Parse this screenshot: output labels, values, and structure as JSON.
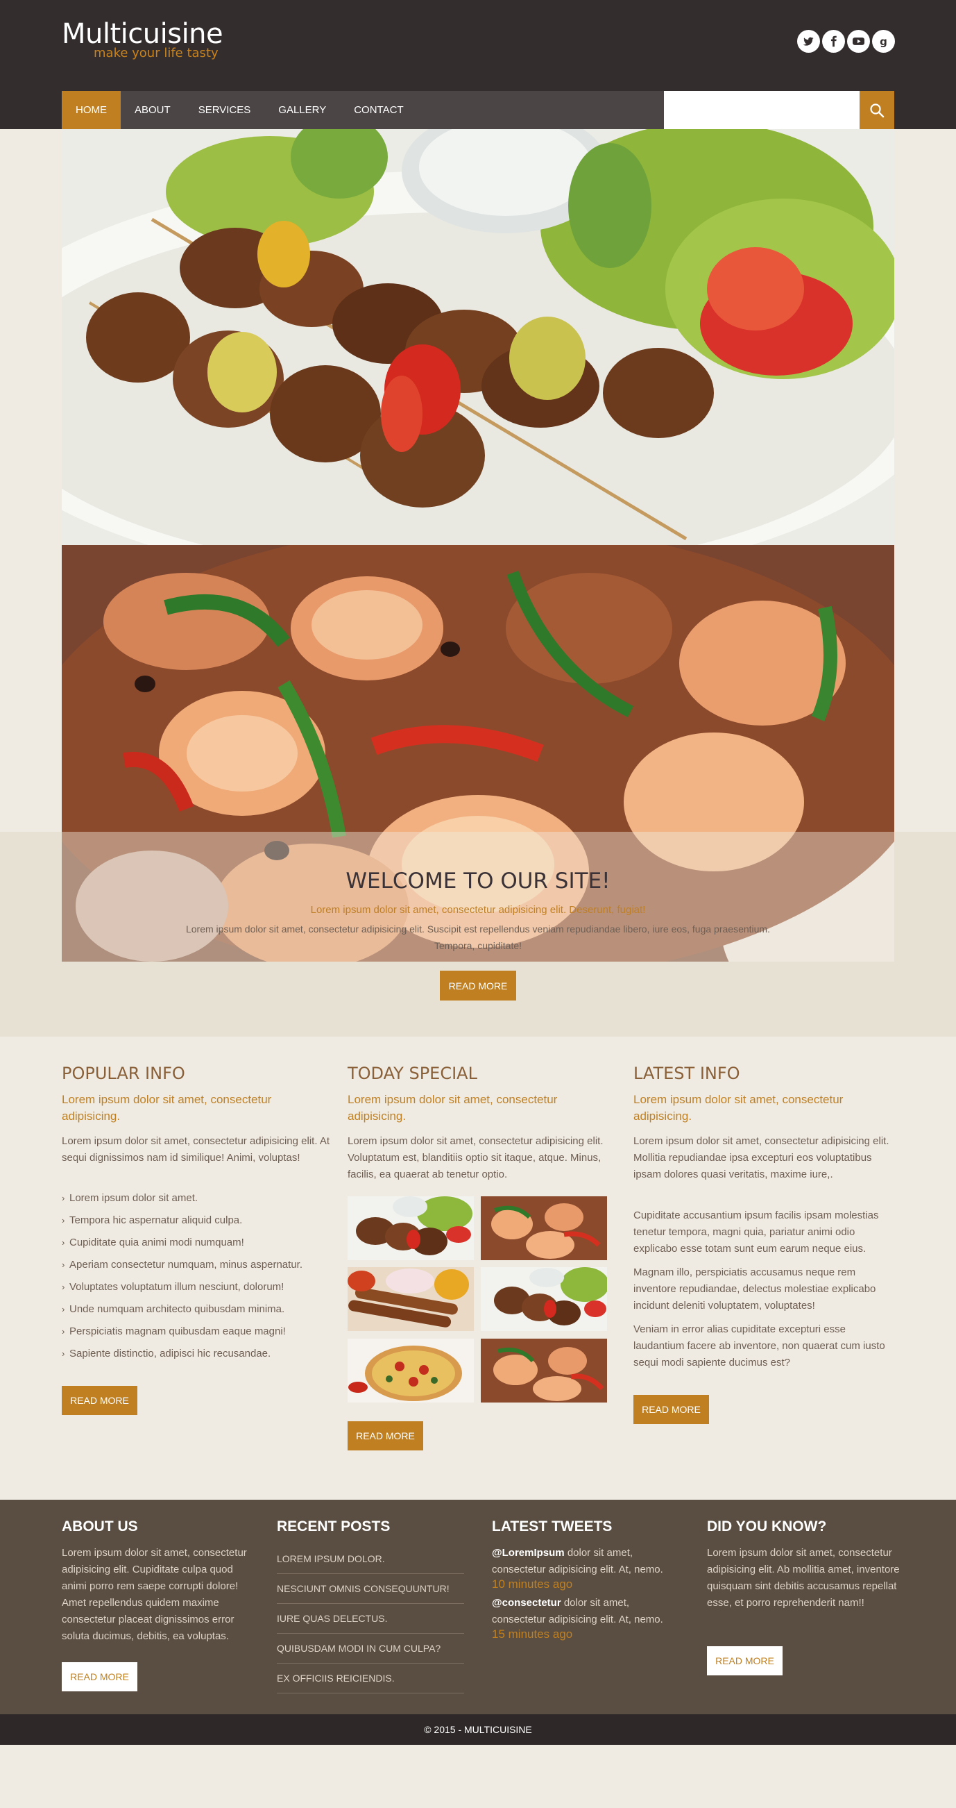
{
  "header": {
    "logo_title": "Multicuisine",
    "logo_tagline": "make your life tasty",
    "social": [
      {
        "icon": "twitter-icon",
        "glyph": "t"
      },
      {
        "icon": "facebook-icon",
        "glyph": "f"
      },
      {
        "icon": "youtube-icon",
        "glyph": "▶"
      },
      {
        "icon": "google-icon",
        "glyph": "g"
      }
    ]
  },
  "nav": {
    "items": [
      "HOME",
      "ABOUT",
      "SERVICES",
      "GALLERY",
      "CONTACT"
    ],
    "active": "HOME"
  },
  "search": {
    "placeholder": "",
    "value": "",
    "icon": "search-icon"
  },
  "welcome": {
    "title": "WELCOME TO OUR SITE!",
    "subtitle": "Lorem ipsum dolor sit amet, consectetur adipisicing elit. Deserunt, fugiat!",
    "body": "Lorem ipsum dolor sit amet, consectetur adipisicing elit. Suscipit est repellendus veniam repudiandae libero, iure eos, fuga praesentium. Tempora, cupiditate!",
    "button": "READ MORE"
  },
  "columns": {
    "popular": {
      "title": "POPULAR INFO",
      "lead": "Lorem ipsum dolor sit amet, consectetur adipisicing.",
      "text": "Lorem ipsum dolor sit amet, consectetur adipisicing elit. At sequi dignissimos nam id similique! Animi, voluptas!",
      "bullets": [
        "Lorem ipsum dolor sit amet.",
        "Tempora hic aspernatur aliquid culpa.",
        "Cupiditate quia animi modi numquam!",
        "Aperiam consectetur numquam, minus aspernatur.",
        "Voluptates voluptatum illum nesciunt, dolorum!",
        "Unde numquam architecto quibusdam minima.",
        "Perspiciatis magnam quibusdam eaque magni!",
        "Sapiente distinctio, adipisci hic recusandae."
      ],
      "button": "READ MORE"
    },
    "special": {
      "title": "TODAY SPECIAL",
      "lead": "Lorem ipsum dolor sit amet, consectetur adipisicing.",
      "text": "Lorem ipsum dolor sit amet, consectetur adipisicing elit. Voluptatum est, blanditiis optio sit itaque, atque. Minus, facilis, ea quaerat ab tenetur optio.",
      "button": "READ MORE"
    },
    "latest": {
      "title": "LATEST INFO",
      "lead": "Lorem ipsum dolor sit amet, consectetur adipisicing.",
      "paragraphs": [
        "Lorem ipsum dolor sit amet, consectetur adipisicing elit. Mollitia repudiandae ipsa excepturi eos voluptatibus ipsam dolores quasi veritatis, maxime iure,.",
        "Cupiditate accusantium ipsum facilis ipsam molestias tenetur tempora, magni quia, pariatur animi odio explicabo esse totam sunt eum earum neque eius.",
        "Magnam illo, perspiciatis accusamus neque rem inventore repudiandae, delectus molestiae explicabo incidunt deleniti voluptatem, voluptates!",
        "Veniam in error alias cupiditate excepturi esse laudantium facere ab inventore, non quaerat cum iusto sequi modi sapiente ducimus est?"
      ],
      "button": "READ MORE"
    }
  },
  "footer": {
    "about": {
      "title": "ABOUT US",
      "text": "Lorem ipsum dolor sit amet, consectetur adipisicing elit. Cupiditate culpa quod animi porro rem saepe corrupti dolore! Amet repellendus quidem maxime consectetur placeat dignissimos error soluta ducimus, debitis, ea voluptas.",
      "button": "READ MORE"
    },
    "recent": {
      "title": "RECENT POSTS",
      "posts": [
        "LOREM IPSUM DOLOR.",
        "NESCIUNT OMNIS CONSEQUUNTUR!",
        "IURE QUAS DELECTUS.",
        "QUIBUSDAM MODI IN CUM CULPA?",
        "EX OFFICIIS REICIENDIS."
      ]
    },
    "tweets": {
      "title": "LATEST TWEETS",
      "items": [
        {
          "handle": "@LoremIpsum",
          "text": " dolor sit amet, consectetur adipisicing elit. At, nemo.",
          "time": "10 minutes ago"
        },
        {
          "handle": "@consectetur",
          "text": " dolor sit amet, consectetur adipisicing elit. At, nemo.",
          "time": "15 minutes ago"
        }
      ]
    },
    "know": {
      "title": "DID YOU KNOW?",
      "text": "Lorem ipsum dolor sit amet, consectetur adipisicing elit. Ab mollitia amet, inventore quisquam sint debitis accusamus repellat esse, et porro reprehenderit nam!!",
      "button": "READ MORE"
    },
    "copyright": "© 2015 - MULTICUISINE"
  },
  "colors": {
    "header_bg": "#332d2e",
    "accent": "#c08021",
    "page_bg": "#efebe3",
    "footer_bg": "#5a4e42",
    "copyright_bg": "#2e2828"
  }
}
